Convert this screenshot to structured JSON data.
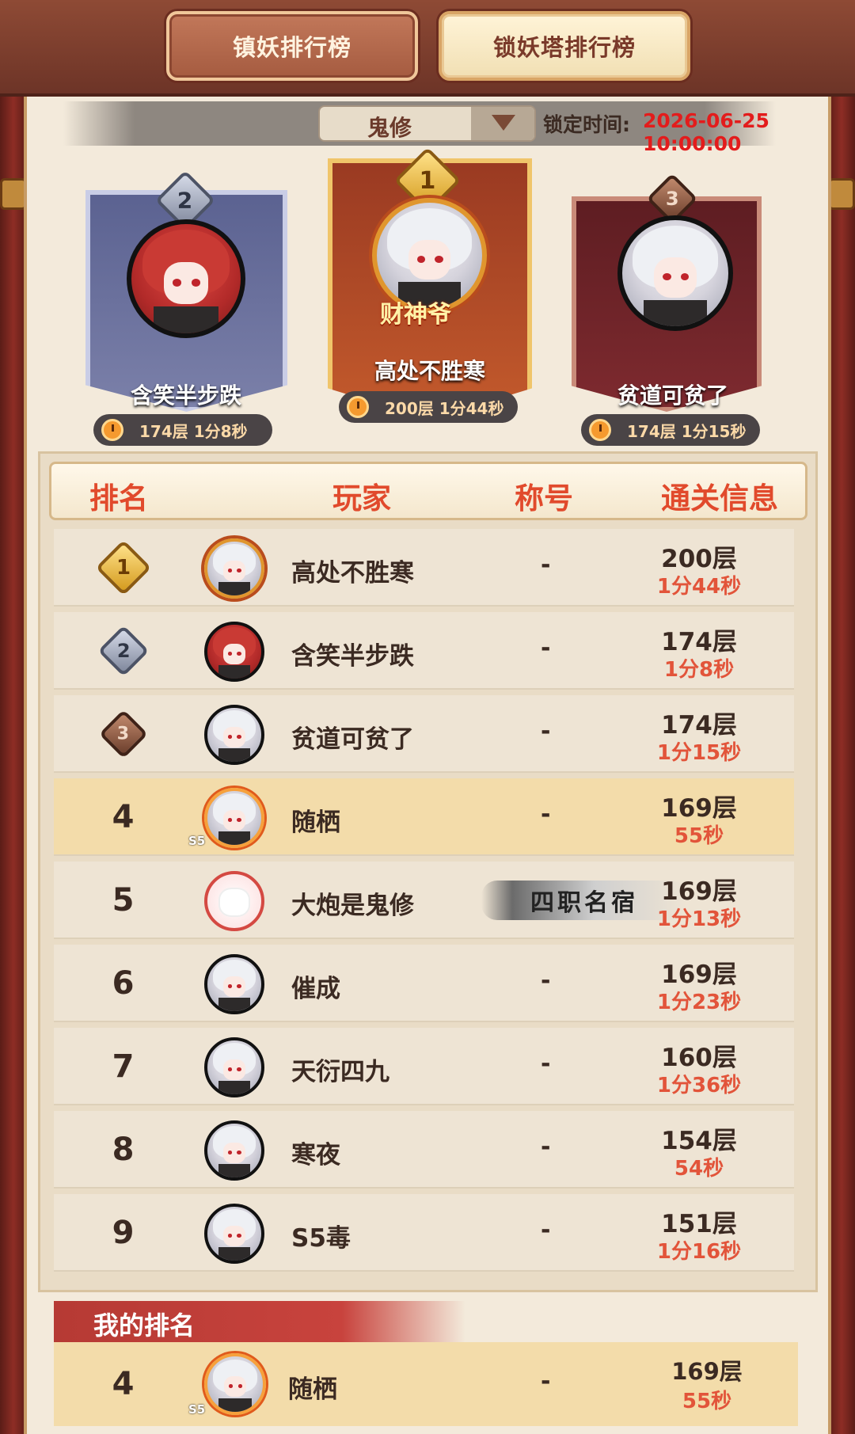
{
  "tabs": [
    {
      "label": "镇妖排行榜",
      "active": false
    },
    {
      "label": "锁妖塔排行榜",
      "active": true
    }
  ],
  "filter": {
    "selected": "鬼修",
    "lock_label": "锁定时间:",
    "lock_time": "2026-06-25 10:00:00"
  },
  "podium": {
    "first": {
      "rank": "1",
      "name": "高处不胜寒",
      "title_tag": "财神爷",
      "floor_time": "200层 1分44秒"
    },
    "second": {
      "rank": "2",
      "name": "含笑半步跌",
      "floor_time": "174层 1分8秒"
    },
    "third": {
      "rank": "3",
      "name": "贫道可贫了",
      "floor_time": "174层 1分15秒"
    }
  },
  "table": {
    "headers": [
      "排名",
      "玩家",
      "称号",
      "通关信息"
    ],
    "rows": [
      {
        "rank": "1",
        "name": "高处不胜寒",
        "title": "-",
        "floor": "200层",
        "time": "1分44秒"
      },
      {
        "rank": "2",
        "name": "含笑半步跌",
        "title": "-",
        "floor": "174层",
        "time": "1分8秒"
      },
      {
        "rank": "3",
        "name": "贫道可贫了",
        "title": "-",
        "floor": "174层",
        "time": "1分15秒"
      },
      {
        "rank": "4",
        "name": "随栖",
        "title": "-",
        "floor": "169层",
        "time": "55秒",
        "avatar_tag": "S5"
      },
      {
        "rank": "5",
        "name": "大炮是鬼修",
        "title": "四职名宿",
        "floor": "169层",
        "time": "1分13秒"
      },
      {
        "rank": "6",
        "name": "催成",
        "title": "-",
        "floor": "169层",
        "time": "1分23秒"
      },
      {
        "rank": "7",
        "name": "天衍四九",
        "title": "-",
        "floor": "160层",
        "time": "1分36秒"
      },
      {
        "rank": "8",
        "name": "寒夜",
        "title": "-",
        "floor": "154层",
        "time": "54秒"
      },
      {
        "rank": "9",
        "name": "S5毒",
        "title": "-",
        "floor": "151层",
        "time": "1分16秒"
      }
    ]
  },
  "my_rank": {
    "label": "我的排名",
    "rank": "4",
    "name": "随栖",
    "title": "-",
    "floor": "169层",
    "time": "55秒",
    "avatar_tag": "S5"
  },
  "colors": {
    "accent_red": "#e14a2c",
    "lock_time_red": "#e31c1c",
    "highlight_row": "#f3dcaa"
  }
}
